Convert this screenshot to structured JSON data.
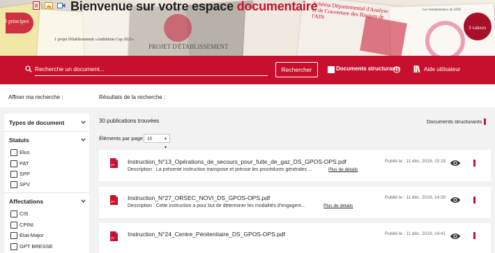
{
  "header": {
    "title_part1": "Bienvenue sur votre espace ",
    "title_part2": "documentaire",
    "icons": [
      "pdf-file-icon",
      "image-file-icon",
      "video-file-icon"
    ],
    "banner_texts": {
      "t1": "3 principes",
      "t2": "1 projet d'établissement «Ambitions Cap 2021»",
      "t3": "PROJET D'ÉTABLISSEMENT",
      "t4": "Schéma Départemental d'Analyse et de Couverture des Risques de l'AIN",
      "t5": "Les fondamentaux du SDIS",
      "t6": "3 valeurs"
    }
  },
  "search": {
    "placeholder": "Recherche un document...",
    "button_label": "Rechercher",
    "structurants_label": "Documents structurants",
    "aide_label": "Aide utilisateur"
  },
  "labels": {
    "affiner": "Affiner ma recherche :",
    "resultats": "Résultats de la recherche :"
  },
  "sidebar": {
    "types_label": "Types de document",
    "statuts_label": "Statuts",
    "statuts": [
      "Elus",
      "PAT",
      "SPP",
      "SPV"
    ],
    "affectations_label": "Affectations",
    "affectations": [
      "CIS",
      "CPINI",
      "Etat-Major",
      "GPT BRESSE"
    ]
  },
  "results": {
    "count_text": "30 publications trouvées",
    "structurants_label": "Documents structurants",
    "per_page_label": "Éléments par page",
    "per_page_value": "10",
    "items": [
      {
        "title": "Instruction_N°13_Opérations_de_secours_pour_fuite_de_gaz_DS_GPOS-OPS.pdf",
        "description": "Description : La présente instruction transpose et précise les procédures générales ...",
        "more": "Plus de détails",
        "date": "Publié le : 11 déc. 2019, 15:15"
      },
      {
        "title": "Instruction_N°27_ORSEC_NOVI_DS_GPOS-OPS.pdf",
        "description": "Description : Cette instruction a pour but de déterminer les modalités d'engagem...",
        "more": "Plus de détails",
        "date": "Publié le : 11 déc. 2019, 14:30"
      },
      {
        "title": "Instruction_N°24_Centre_Pénitentiaire_DS_GPOS-OPS.pdf",
        "description": "",
        "more": "",
        "date": "Publié le : 11 déc. 2019, 14:41"
      }
    ]
  },
  "colors": {
    "brand_red": "#c8102e",
    "panel_grey": "#f2f2f2"
  }
}
